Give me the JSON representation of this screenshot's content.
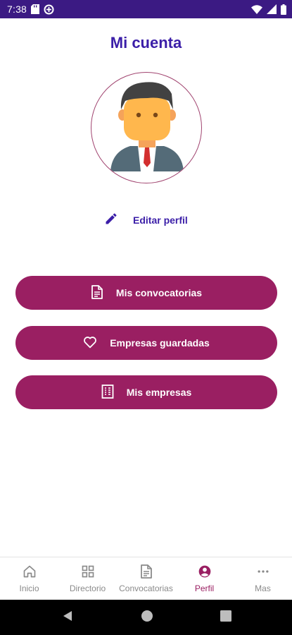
{
  "status_bar": {
    "time": "7:38",
    "icons_left": [
      "sd-card-icon",
      "data-saver-icon"
    ],
    "icons_right": [
      "wifi-icon",
      "signal-icon",
      "battery-icon"
    ]
  },
  "page": {
    "title": "Mi cuenta",
    "avatar": "businessman-avatar",
    "edit_profile_label": "Editar perfil"
  },
  "actions": [
    {
      "label": "Mis convocatorias",
      "icon": "document-icon"
    },
    {
      "label": "Empresas guardadas",
      "icon": "heart-icon"
    },
    {
      "label": "Mis empresas",
      "icon": "building-icon"
    }
  ],
  "bottom_nav": {
    "active": "Perfil",
    "items": [
      {
        "label": "Inicio",
        "icon": "home-icon"
      },
      {
        "label": "Directorio",
        "icon": "grid-icon"
      },
      {
        "label": "Convocatorias",
        "icon": "document-icon"
      },
      {
        "label": "Perfil",
        "icon": "account-circle-icon"
      },
      {
        "label": "Mas",
        "icon": "more-horizontal-icon"
      }
    ]
  },
  "colors": {
    "status_bar": "#3b1a83",
    "title": "#3b1ea8",
    "accent": "#9a1f62",
    "nav_inactive": "#8a8a8a"
  }
}
